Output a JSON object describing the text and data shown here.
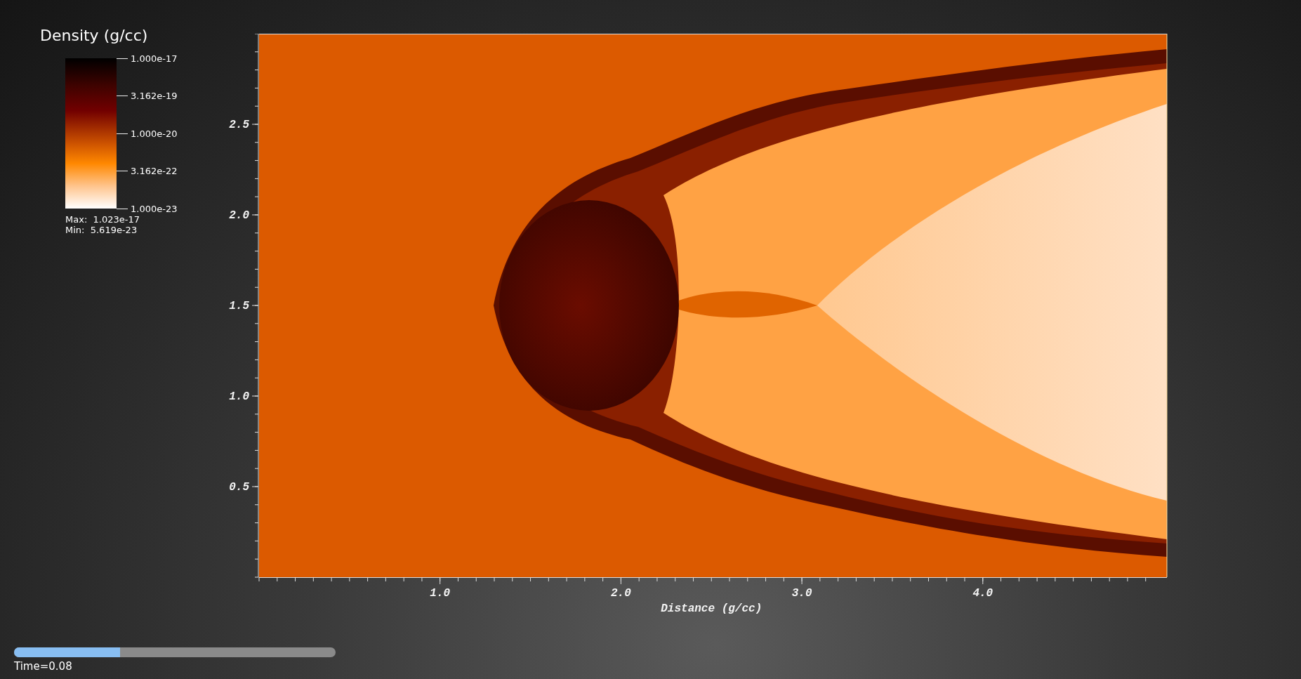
{
  "legend": {
    "title": "Density (g/cc)",
    "ticks": [
      "1.000e-17",
      "3.162e-19",
      "1.000e-20",
      "3.162e-22",
      "1.000e-23"
    ],
    "max": "Max:  1.023e-17",
    "min": "Min:  5.619e-23"
  },
  "plot": {
    "x_axis": {
      "title": "Distance (g/cc)",
      "ticks": [
        "1.0",
        "2.0",
        "3.0",
        "4.0"
      ]
    },
    "y_axis": {
      "ticks": [
        "2.5",
        "2.0",
        "1.5",
        "1.0",
        "0.5"
      ]
    }
  },
  "time_slider": {
    "level": 0.33,
    "label": "Time=0.08"
  }
}
